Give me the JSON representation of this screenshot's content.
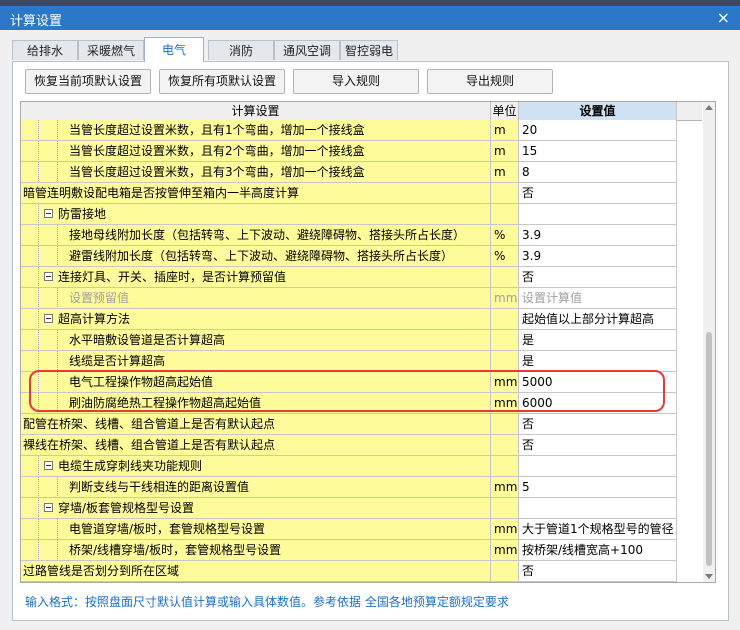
{
  "window": {
    "title": "计算设置",
    "close_glyph": "×"
  },
  "tabs": [
    {
      "label": "给排水",
      "active": false
    },
    {
      "label": "采暖燃气",
      "active": false
    },
    {
      "label": "电气",
      "active": true
    },
    {
      "label": "消防",
      "active": false
    },
    {
      "label": "通风空调",
      "active": false
    },
    {
      "label": "智控弱电",
      "active": false
    }
  ],
  "toolbar": {
    "restore_current": "恢复当前项默认设置",
    "restore_all": "恢复所有项默认设置",
    "import_rules": "导入规则",
    "export_rules": "导出规则"
  },
  "table": {
    "headers": {
      "setting": "计算设置",
      "unit": "单位",
      "value": "设置值"
    },
    "rows": [
      {
        "label": "当管长度超过设置米数，且有1个弯曲，增加一个接线盒",
        "unit": "m",
        "value": "20",
        "level": 2
      },
      {
        "label": "当管长度超过设置米数，且有2个弯曲，增加一个接线盒",
        "unit": "m",
        "value": "15",
        "level": 2
      },
      {
        "label": "当管长度超过设置米数，且有3个弯曲，增加一个接线盒",
        "unit": "m",
        "value": "8",
        "level": 2
      },
      {
        "label": "暗管连明敷设配电箱是否按管伸至箱内一半高度计算",
        "unit": "",
        "value": "否",
        "level": 0
      },
      {
        "label": "防雷接地",
        "unit": "",
        "value": "",
        "level": 1,
        "group": true
      },
      {
        "label": "接地母线附加长度（包括转弯、上下波动、避绕障碍物、搭接头所占长度）",
        "unit": "%",
        "value": "3.9",
        "level": 2
      },
      {
        "label": "避雷线附加长度（包括转弯、上下波动、避绕障碍物、搭接头所占长度）",
        "unit": "%",
        "value": "3.9",
        "level": 2
      },
      {
        "label": "连接灯具、开关、插座时，是否计算预留值",
        "unit": "",
        "value": "否",
        "level": 1,
        "group": true
      },
      {
        "label": "设置预留值",
        "unit": "mm",
        "value": "设置计算值",
        "level": 2,
        "disabled": true
      },
      {
        "label": "超高计算方法",
        "unit": "",
        "value": "起始值以上部分计算超高",
        "level": 1,
        "group": true
      },
      {
        "label": "水平暗敷设管道是否计算超高",
        "unit": "",
        "value": "是",
        "level": 2
      },
      {
        "label": "线缆是否计算超高",
        "unit": "",
        "value": "是",
        "level": 2
      },
      {
        "label": "电气工程操作物超高起始值",
        "unit": "mm",
        "value": "5000",
        "level": 2
      },
      {
        "label": "刷油防腐绝热工程操作物超高起始值",
        "unit": "mm",
        "value": "6000",
        "level": 2
      },
      {
        "label": "配管在桥架、线槽、组合管道上是否有默认起点",
        "unit": "",
        "value": "否",
        "level": 0
      },
      {
        "label": "裸线在桥架、线槽、组合管道上是否有默认起点",
        "unit": "",
        "value": "否",
        "level": 0
      },
      {
        "label": "电缆生成穿刺线夹功能规则",
        "unit": "",
        "value": "",
        "level": 1,
        "group": true
      },
      {
        "label": "判断支线与干线相连的距离设置值",
        "unit": "mm",
        "value": "5",
        "level": 2
      },
      {
        "label": "穿墙/板套管规格型号设置",
        "unit": "",
        "value": "",
        "level": 1,
        "group": true
      },
      {
        "label": "电管道穿墙/板时，套管规格型号设置",
        "unit": "mm",
        "value": "大于管道1个规格型号的管径",
        "level": 2
      },
      {
        "label": "桥架/线槽穿墙/板时，套管规格型号设置",
        "unit": "mm",
        "value": "按桥架/线槽宽高+100",
        "level": 2
      },
      {
        "label": "过路管线是否划分到所在区域",
        "unit": "",
        "value": "否",
        "level": 0
      }
    ]
  },
  "footer": {
    "hint": "输入格式：按照盘面尺寸默认值计算或输入具体数值。参考依据 全国各地预算定额规定要求"
  },
  "colors": {
    "title_bar": "#2b78c9",
    "label_cell": "#fefb9a",
    "highlight_border": "#e53a3a",
    "hint_text": "#1f6fc5"
  }
}
